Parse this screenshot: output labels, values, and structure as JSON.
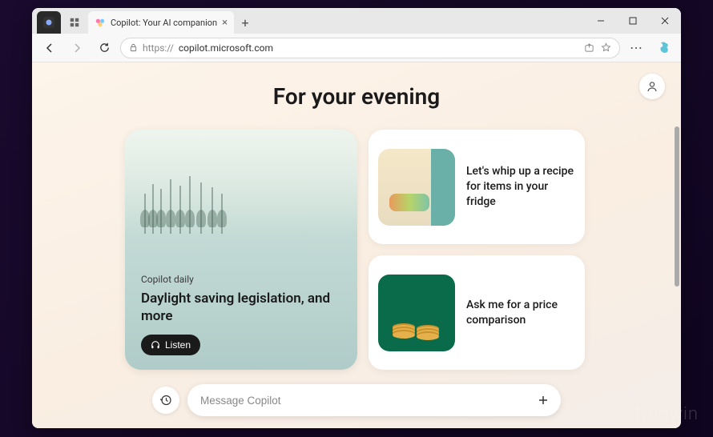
{
  "browser": {
    "tab_title": "Copilot: Your AI companion",
    "url_scheme": "https://",
    "url_host": "copilot.microsoft.com",
    "url_path": ""
  },
  "page": {
    "heading": "For your evening",
    "profile_icon": "person-icon"
  },
  "hero": {
    "eyebrow": "Copilot daily",
    "title": "Daylight saving legislation, and more",
    "listen_label": "Listen"
  },
  "cards": [
    {
      "id": "fridge",
      "text": "Let's whip up a recipe for items in your fridge"
    },
    {
      "id": "coins",
      "text": "Ask me for a price comparison"
    }
  ],
  "input": {
    "placeholder": "Message Copilot"
  },
  "watermark": "Neowin"
}
